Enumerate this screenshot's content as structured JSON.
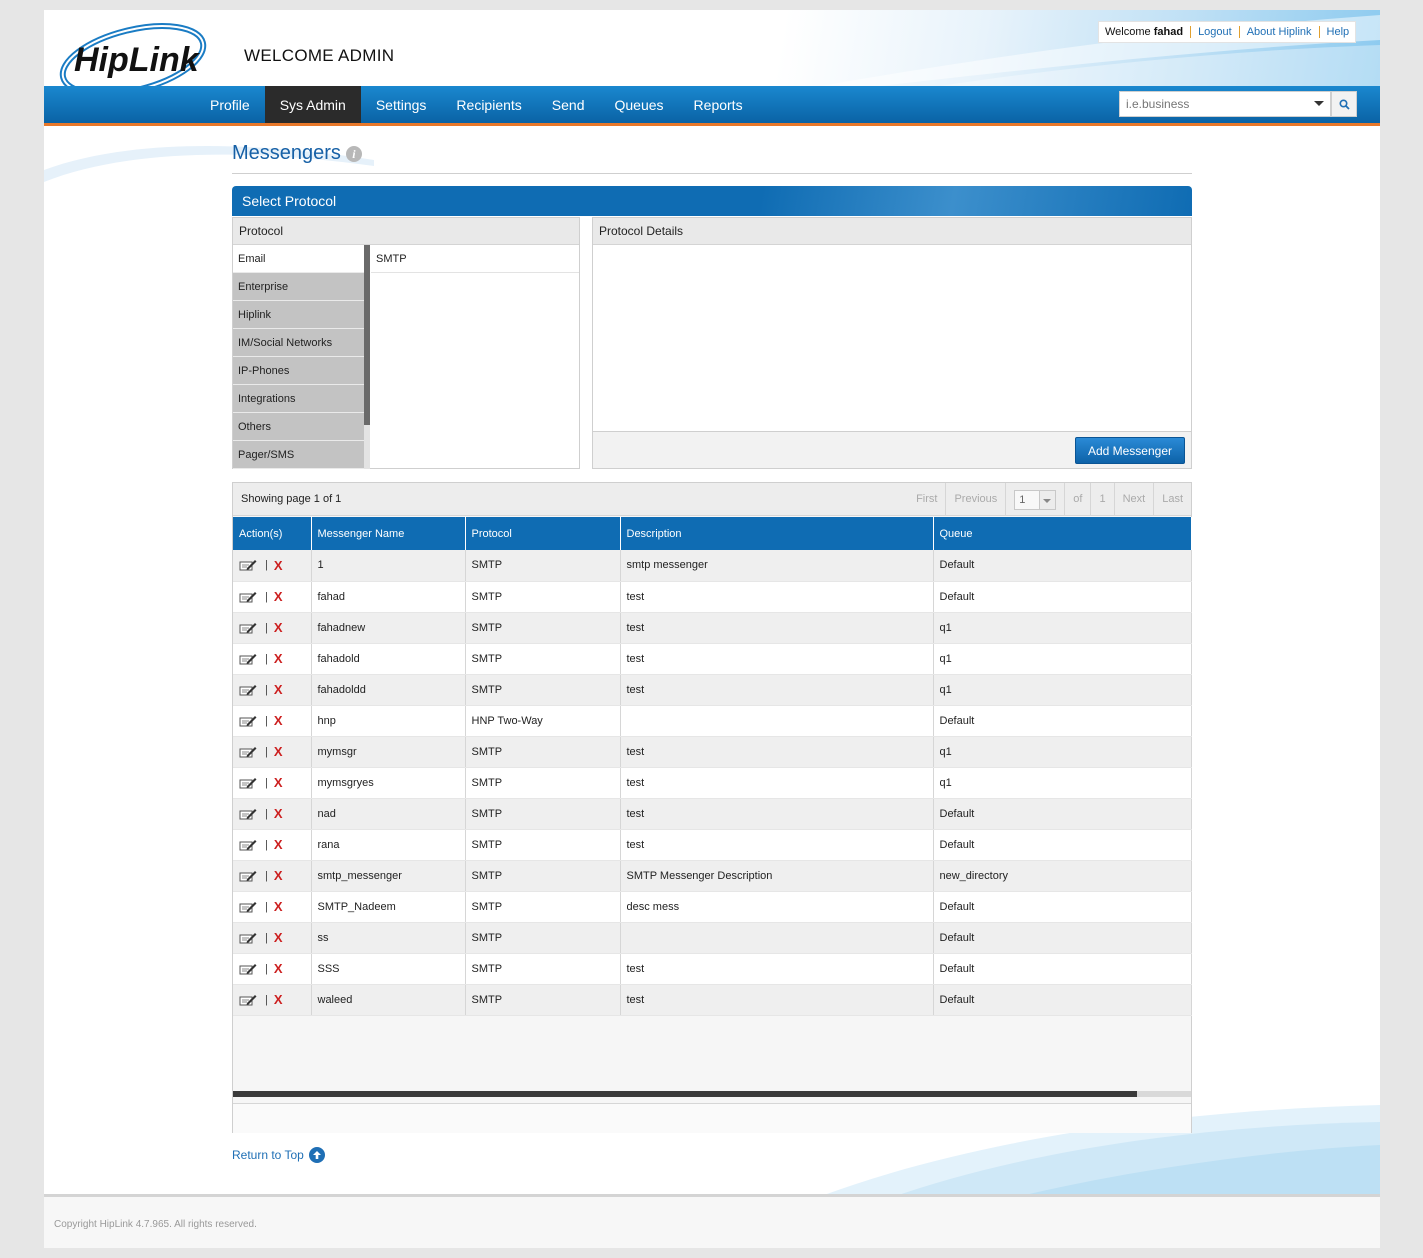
{
  "header": {
    "logo_text": "HipLink",
    "welcome_admin": "WELCOME ADMIN",
    "user_bar": {
      "welcome_prefix": "Welcome",
      "username": "fahad",
      "logout": "Logout",
      "about": "About Hiplink",
      "help": "Help"
    }
  },
  "nav": {
    "items": [
      "Profile",
      "Sys Admin",
      "Settings",
      "Recipients",
      "Send",
      "Queues",
      "Reports"
    ],
    "active": "Sys Admin",
    "search_placeholder": "i.e.business",
    "search_icon": "search-icon"
  },
  "page": {
    "title": "Messengers",
    "info_icon": "i",
    "select_protocol": "Select Protocol"
  },
  "protocol_panel": {
    "header": "Protocol",
    "categories": [
      "Email",
      "Enterprise",
      "Hiplink",
      "IM/Social Networks",
      "IP-Phones",
      "Integrations",
      "Others",
      "Pager/SMS"
    ],
    "selected_category": "Email",
    "protocols": [
      "SMTP"
    ]
  },
  "details_panel": {
    "header": "Protocol Details",
    "add_button": "Add Messenger"
  },
  "grid": {
    "showing": "Showing page 1 of 1",
    "pager": {
      "first": "First",
      "previous": "Previous",
      "page": "1",
      "of": "of",
      "total": "1",
      "next": "Next",
      "last": "Last"
    },
    "columns": [
      "Action(s)",
      "Messenger Name",
      "Protocol",
      "Description",
      "Queue"
    ],
    "action_separator": "|",
    "delete_glyph": "X",
    "rows": [
      {
        "name": "1",
        "protocol": "SMTP",
        "description": "smtp messenger",
        "queue": "Default"
      },
      {
        "name": "fahad",
        "protocol": "SMTP",
        "description": "test",
        "queue": "Default"
      },
      {
        "name": "fahadnew",
        "protocol": "SMTP",
        "description": "test",
        "queue": "q1"
      },
      {
        "name": "fahadold",
        "protocol": "SMTP",
        "description": "test",
        "queue": "q1"
      },
      {
        "name": "fahadoldd",
        "protocol": "SMTP",
        "description": "test",
        "queue": "q1"
      },
      {
        "name": "hnp",
        "protocol": "HNP Two-Way",
        "description": "",
        "queue": "Default"
      },
      {
        "name": "mymsgr",
        "protocol": "SMTP",
        "description": "test",
        "queue": "q1"
      },
      {
        "name": "mymsgryes",
        "protocol": "SMTP",
        "description": "test",
        "queue": "q1"
      },
      {
        "name": "nad",
        "protocol": "SMTP",
        "description": "test",
        "queue": "Default"
      },
      {
        "name": "rana",
        "protocol": "SMTP",
        "description": "test",
        "queue": "Default"
      },
      {
        "name": "smtp_messenger",
        "protocol": "SMTP",
        "description": "SMTP Messenger Description",
        "queue": "new_directory"
      },
      {
        "name": "SMTP_Nadeem",
        "protocol": "SMTP",
        "description": "desc mess",
        "queue": "Default"
      },
      {
        "name": "ss",
        "protocol": "SMTP",
        "description": "",
        "queue": "Default"
      },
      {
        "name": "SSS",
        "protocol": "SMTP",
        "description": "test",
        "queue": "Default"
      },
      {
        "name": "waleed",
        "protocol": "SMTP",
        "description": "test",
        "queue": "Default"
      }
    ]
  },
  "return_to_top": "Return to Top",
  "footer": {
    "copyright": "Copyright HipLink 4.7.965. All rights reserved."
  },
  "colors": {
    "nav_blue": "#0f6cb3",
    "nav_accent": "#e8782a",
    "link": "#1f6fb5",
    "delete": "#cc1f1f"
  }
}
